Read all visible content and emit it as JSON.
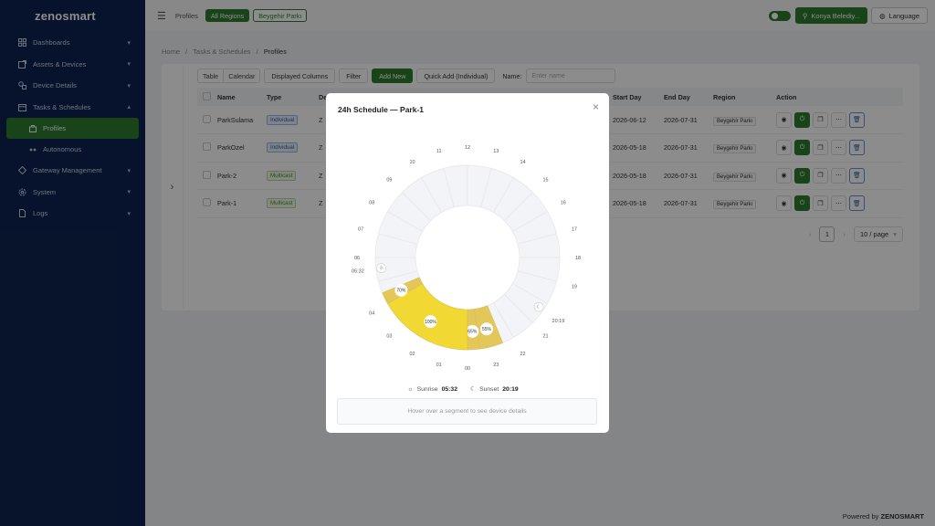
{
  "app": {
    "logo_text": "zenosmart"
  },
  "sidebar": {
    "items": [
      {
        "label": "Dashboards",
        "icon": "grid-icon",
        "chevron": "▾"
      },
      {
        "label": "Assets & Devices",
        "icon": "box-icon",
        "chevron": "▾"
      },
      {
        "label": "Device Details",
        "icon": "device-icon",
        "chevron": "▾"
      },
      {
        "label": "Tasks & Schedules",
        "icon": "calendar-icon",
        "chevron": "▴"
      },
      {
        "label": "Gateway Management",
        "icon": "gateway-icon",
        "chevron": "▾"
      },
      {
        "label": "System",
        "icon": "gear-icon",
        "chevron": "▾"
      },
      {
        "label": "Logs",
        "icon": "file-icon",
        "chevron": "▾"
      }
    ],
    "subitems": [
      {
        "label": "Profiles",
        "active": true
      },
      {
        "label": "Autonomous",
        "active": false
      }
    ]
  },
  "topbar": {
    "title": "Profiles",
    "all_regions": "All Regions",
    "region_chip": "Beygehir Parkı",
    "user_label": "Konya Belediy...",
    "language_label": "Language"
  },
  "breadcrumb": {
    "home": "Home",
    "section": "Tasks & Schedules",
    "current": "Profiles",
    "sep": "/"
  },
  "toolbar": {
    "view_table": "Table",
    "view_calendar": "Calendar",
    "displayed_columns": "Displayed Columns",
    "filter": "Filter",
    "add_new": "Add New",
    "quick_add": "Quick Add (Individual)",
    "name_label": "Name:",
    "name_placeholder": "Enter name"
  },
  "table": {
    "columns": {
      "name": "Name",
      "type": "Type",
      "de": "De",
      "start": "Start Day",
      "end": "End Day",
      "region": "Region",
      "action": "Action"
    },
    "rows": [
      {
        "name": "ParkSulama",
        "type": "Individual",
        "de": "Z",
        "start": "2026-06-12",
        "end": "2026-07-31",
        "region": "Beygehir Parkı"
      },
      {
        "name": "ParkOzel",
        "type": "Individual",
        "de": "Z",
        "start": "2026-05-18",
        "end": "2026-07-31",
        "region": "Beygehir Parkı"
      },
      {
        "name": "Park-2",
        "type": "Multicast",
        "de": "Z",
        "start": "2026-05-18",
        "end": "2026-07-31",
        "region": "Beygehir Parkı"
      },
      {
        "name": "Park-1",
        "type": "Multicast",
        "de": "Z",
        "start": "2026-05-18",
        "end": "2026-07-31",
        "region": "Beygehir Parkı"
      }
    ]
  },
  "pagination": {
    "page": "1",
    "page_size": "10 / page",
    "prev": "‹",
    "next": "›"
  },
  "footer": {
    "prefix": "Powered by",
    "brand": "ZENOSMART"
  },
  "modal": {
    "title": "24h Schedule — Park-1",
    "close": "×",
    "hour_labels": [
      "00",
      "01",
      "02",
      "03",
      "04",
      "05:32",
      "06",
      "07",
      "08",
      "09",
      "10",
      "11",
      "12",
      "13",
      "14",
      "15",
      "16",
      "17",
      "18",
      "19",
      "20:19",
      "21",
      "22",
      "23"
    ],
    "segments": [
      {
        "from_hour": 22.5,
        "to_hour": 23.5,
        "level_label": "55%",
        "color": "#e3c75a"
      },
      {
        "from_hour": 23.5,
        "to_hour": 24.0,
        "level_label": "65%",
        "color": "#e3c75a"
      },
      {
        "from_hour": 0.0,
        "to_hour": 4.0,
        "level_label": "100%",
        "color": "#f2d832"
      },
      {
        "from_hour": 4.0,
        "to_hour": 4.5,
        "level_label": "70%",
        "color": "#e3c75a"
      }
    ],
    "sunrise_label": "Sunrise",
    "sunrise_time": "05:32",
    "sunset_label": "Sunset",
    "sunset_time": "20:19",
    "hover_hint": "Hover over a segment to see device details"
  },
  "colors": {
    "brand_green": "#2e7d2e",
    "sidebar_bg": "#0e2350",
    "bright_segment": "#f2d832",
    "dim_segment": "#e3c75a"
  }
}
